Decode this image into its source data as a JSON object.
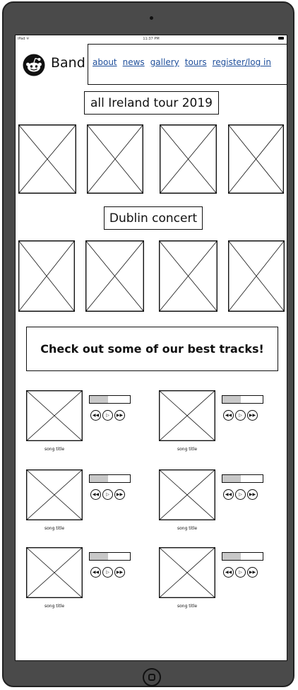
{
  "status_bar": {
    "device": "iPad ᯤ",
    "time": "11:37 PM"
  },
  "header": {
    "logo_icon": "reddit-alien-icon",
    "brand": "Band"
  },
  "nav": {
    "links": [
      {
        "label": "about"
      },
      {
        "label": "news"
      },
      {
        "label": "gallery"
      },
      {
        "label": "tours"
      },
      {
        "label": "register/log in"
      }
    ]
  },
  "sections": {
    "tour_heading": "all Ireland tour 2019",
    "concert_heading": "Dublin concert",
    "tracks_heading": "Check out some of our best tracks!"
  },
  "tracks": [
    {
      "title": "song title",
      "progress": 0.45
    },
    {
      "title": "song title",
      "progress": 0.45
    },
    {
      "title": "song title",
      "progress": 0.45
    },
    {
      "title": "song title",
      "progress": 0.45
    },
    {
      "title": "song title",
      "progress": 0.45
    },
    {
      "title": "song title",
      "progress": 0.45
    }
  ],
  "player_icons": {
    "rewind": "rewind-icon",
    "play": "play-icon",
    "forward": "fast-forward-icon"
  },
  "colors": {
    "link": "#1f4f9b",
    "device": "#4a4a4a",
    "progress_fill": "#c8c8c8"
  }
}
